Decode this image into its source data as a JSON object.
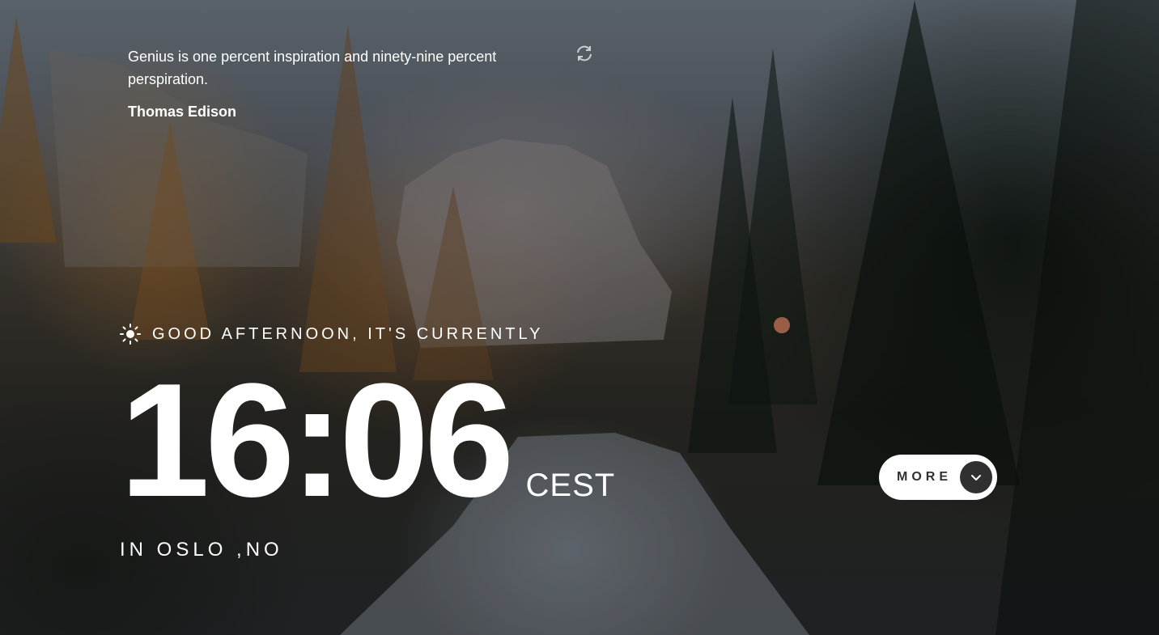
{
  "quote": {
    "text": "Genius is one percent inspiration and ninety-nine percent perspiration.",
    "author": "Thomas Edison",
    "refresh_icon": "refresh-icon"
  },
  "greeting": {
    "icon": "sun-icon",
    "text": "GOOD AFTERNOON, IT'S CURRENTLY"
  },
  "clock": {
    "time": "16:06",
    "timezone": "CEST"
  },
  "location": {
    "text": "IN OSLO ,NO"
  },
  "more_button": {
    "label": "MORE",
    "icon": "chevron-down-icon",
    "background": "#ffffff",
    "icon_background": "#303030"
  }
}
